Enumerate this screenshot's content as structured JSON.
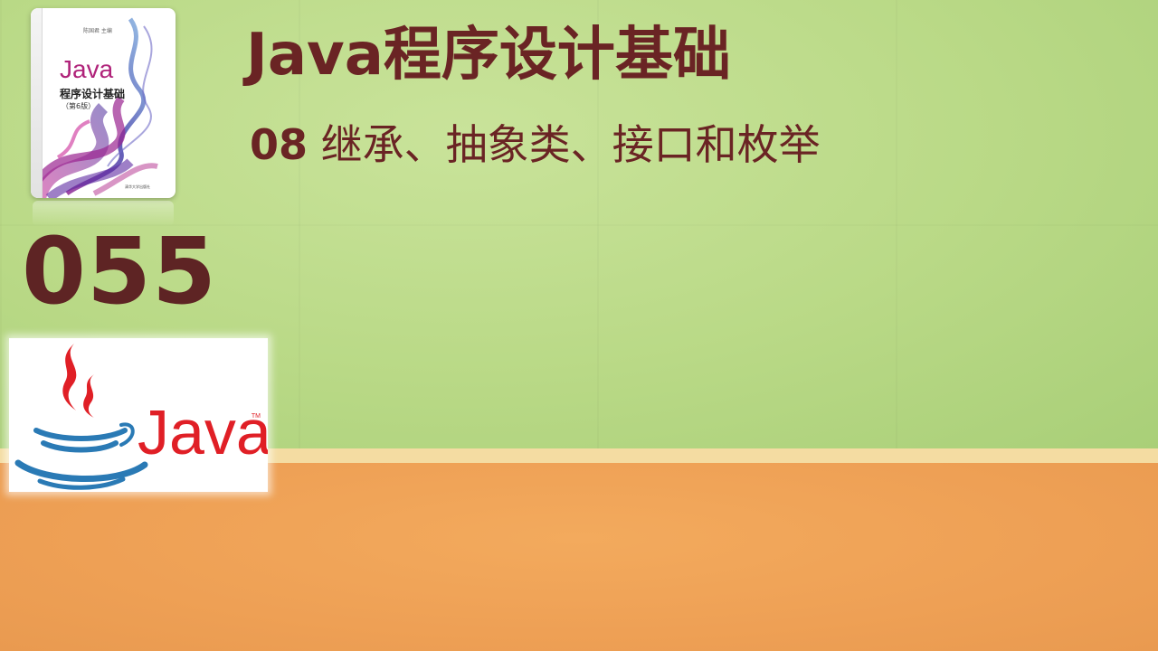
{
  "slide": {
    "title": "Java程序设计基础",
    "chapter_number": "08",
    "chapter_title": "继承、抽象类、接口和枚举",
    "lesson_number": "055"
  },
  "book": {
    "author": "陈国君 主编",
    "java": "Java",
    "name": "程序设计基础",
    "edition": "（第6版）",
    "publisher": "清华大学出版社"
  },
  "logo": {
    "wordmark": "Java",
    "trademark": "TM"
  },
  "colors": {
    "title_text": "#6a2424",
    "top_background": "#b9d986",
    "bottom_background": "#eea055",
    "logo_red": "#e01f26",
    "logo_blue": "#2a7ab5"
  },
  "icons": [
    "java-cup-logo-icon",
    "book-cover-swirl-art"
  ]
}
